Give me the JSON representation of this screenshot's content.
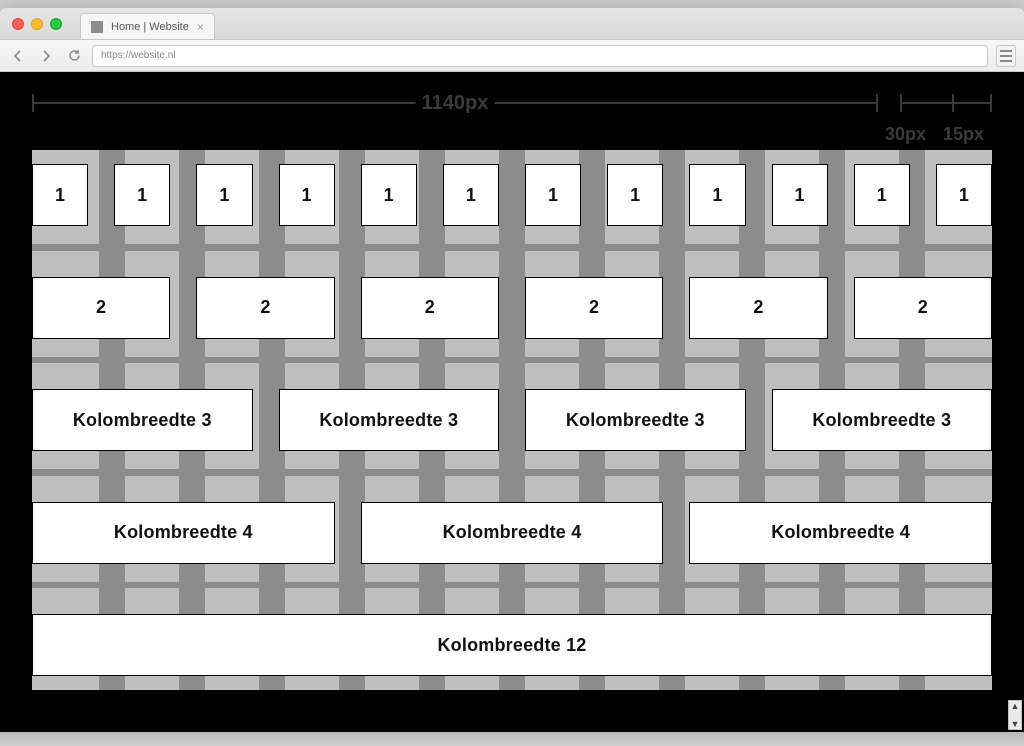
{
  "browser": {
    "tab_title": "Home | Website",
    "url": "https://website.nl"
  },
  "dimensions": {
    "container_label": "1140px",
    "gutter_label": "30px",
    "padding_label": "15px"
  },
  "rows": {
    "r1": {
      "label": "1",
      "count": 12
    },
    "r2": {
      "label": "2",
      "count": 6
    },
    "r3": {
      "label": "Kolombreedte 3",
      "count": 4
    },
    "r4": {
      "label": "Kolombreedte 4",
      "count": 3
    },
    "r12": {
      "label": "Kolombreedte 12",
      "count": 1
    }
  }
}
